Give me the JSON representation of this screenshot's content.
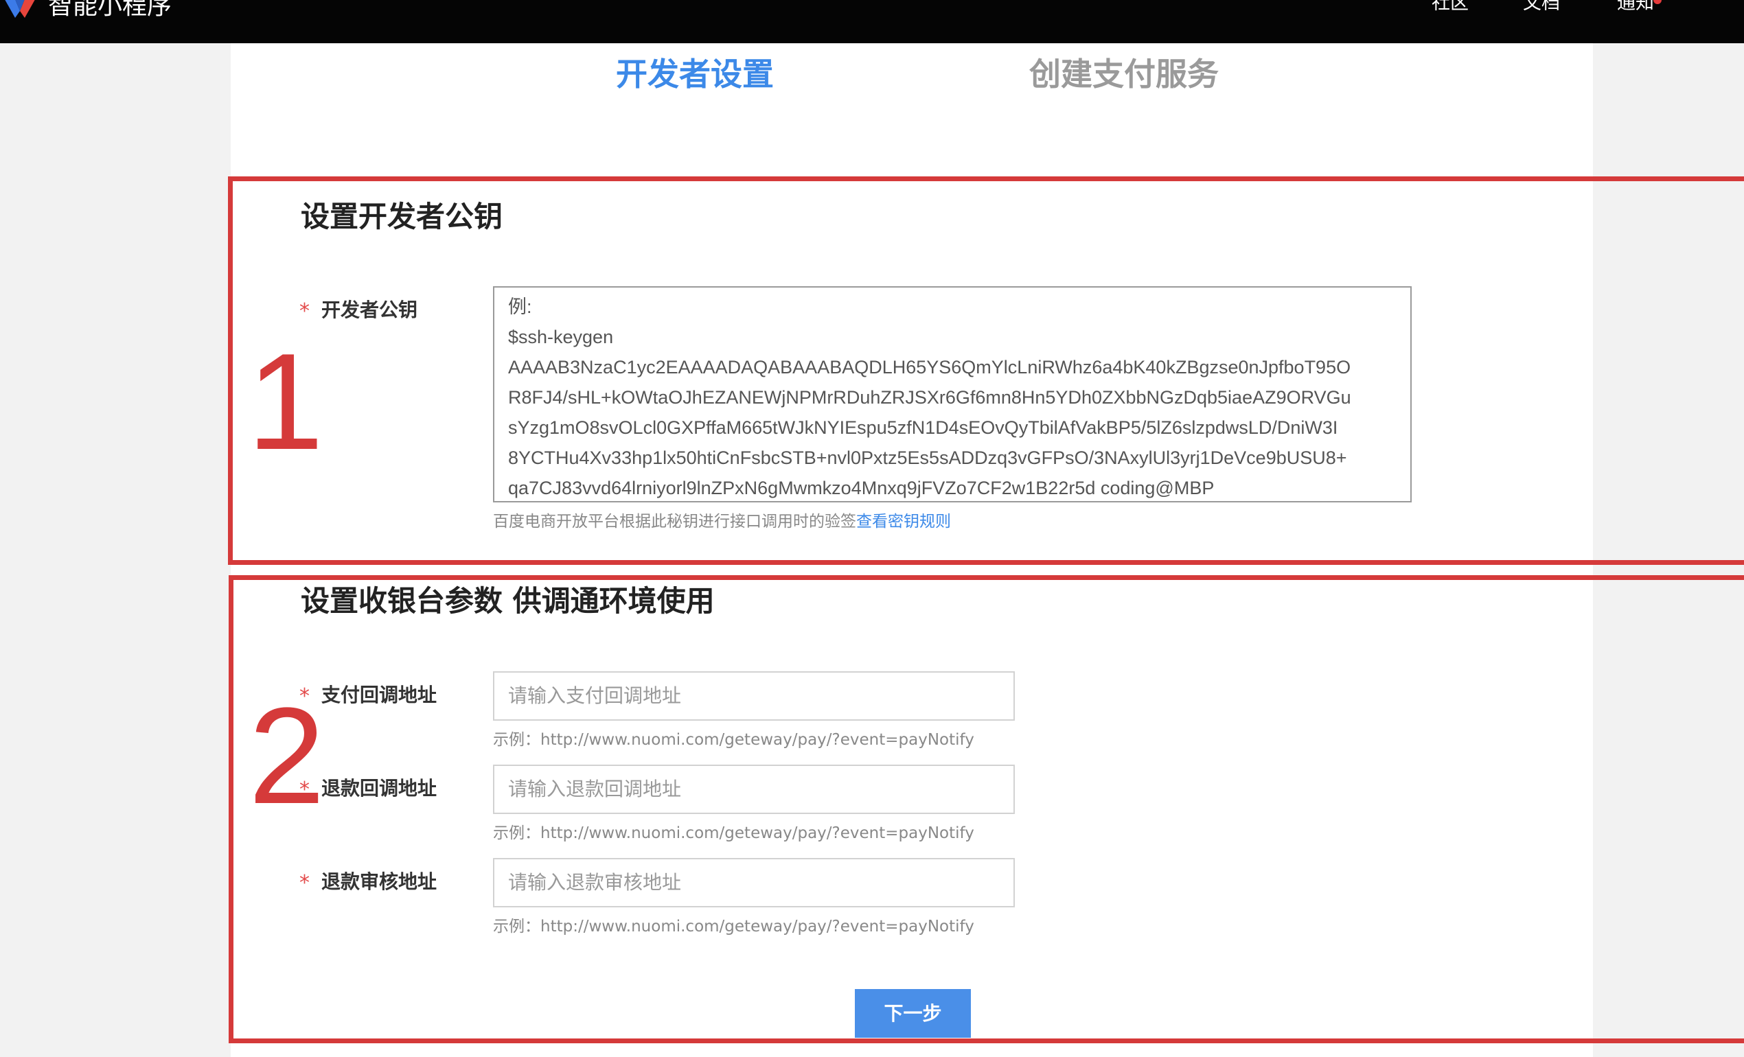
{
  "header": {
    "brand": "智能小程序",
    "nav": [
      "社区",
      "文档",
      "通知"
    ]
  },
  "steps": {
    "active": "开发者设置",
    "inactive": "创建支付服务"
  },
  "annotations": [
    "1",
    "2"
  ],
  "section1": {
    "title": "设置开发者公钥",
    "required_mark": "*",
    "label": "开发者公钥",
    "placeholder_lines": [
      "例:",
      "$ssh-keygen",
      "AAAAB3NzaC1yc2EAAAADAQABAAABAQDLH65YS6QmYlcLniRWhz6a4bK40kZBgzse0nJpfboT95O",
      "R8FJ4/sHL+kOWtaOJhEZANEWjNPMrRDuhZRJSXr6Gf6mn8Hn5YDh0ZXbbNGzDqb5iaeAZ9ORVGu",
      "sYzg1mO8svOLcl0GXPffaM665tWJkNYIEspu5zfN1D4sEOvQyTbilAfVakBP5/5lZ6slzpdwsLD/DniW3I",
      "8YCTHu4Xv33hp1lx50htiCnFsbcSTB+nvl0Pxtz5Es5sADDzq3vGFPsO/3NAxylUl3yrj1DeVce9bUSU8+",
      "qa7CJ83vvd64lrniyorl9lnZPxN6gMwmkzo4Mnxq9jFVZo7CF2w1B22r5d coding@MBP"
    ],
    "hint": "百度电商开放平台根据此秘钥进行接口调用时的验签",
    "hint_link": "查看密钥规则"
  },
  "section2": {
    "title": "设置收银台参数 供调通环境使用",
    "fields": [
      {
        "label": "支付回调地址",
        "placeholder": "请输入支付回调地址",
        "example": "示例：http://www.nuomi.com/geteway/pay/?event=payNotify"
      },
      {
        "label": "退款回调地址",
        "placeholder": "请输入退款回调地址",
        "example": "示例：http://www.nuomi.com/geteway/pay/?event=payNotify"
      },
      {
        "label": "退款审核地址",
        "placeholder": "请输入退款审核地址",
        "example": "示例：http://www.nuomi.com/geteway/pay/?event=payNotify"
      }
    ],
    "next_button": "下一步"
  },
  "colors": {
    "accent": "#3c89e8",
    "annotation_red": "#d53a3a",
    "required_red": "#e34a4a",
    "topbar": "#050505"
  }
}
